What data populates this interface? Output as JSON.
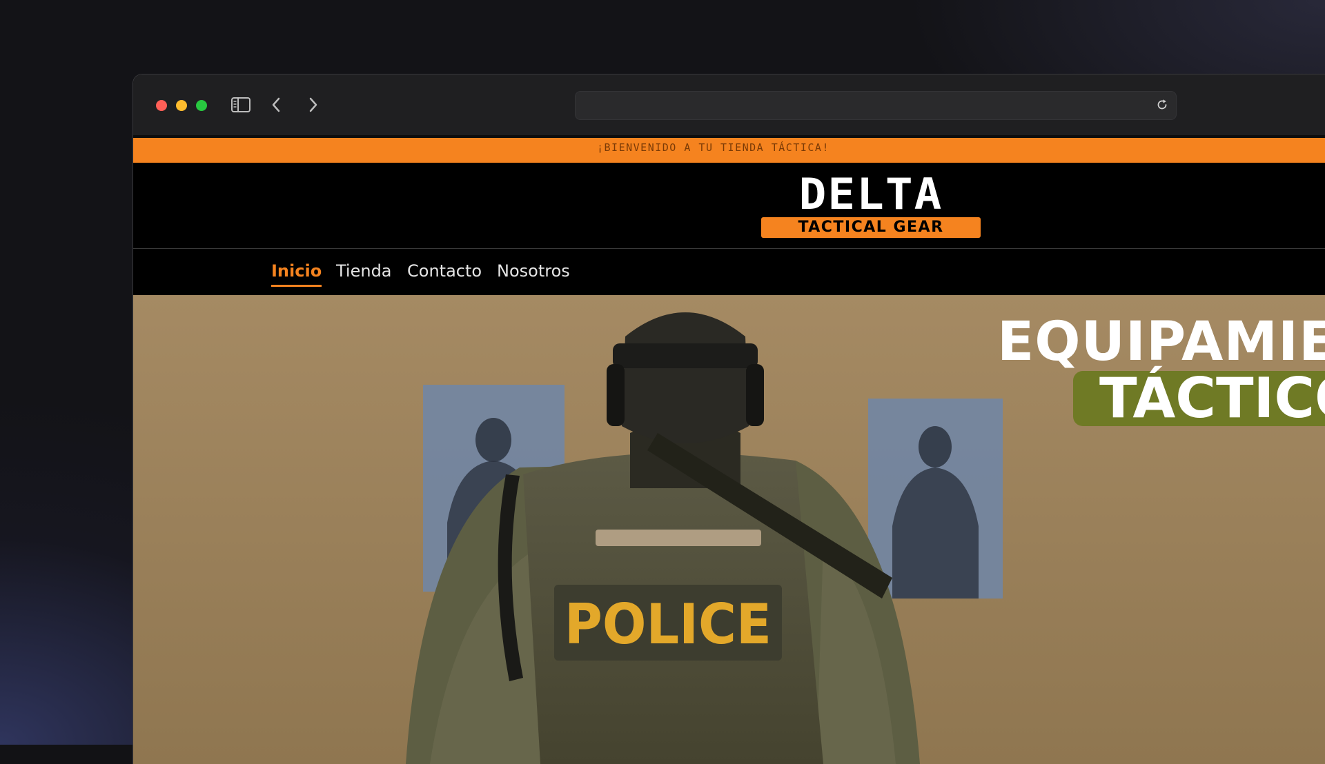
{
  "browser": {
    "url": "",
    "traffic_lights": {
      "close": "#ff5f57",
      "minimize": "#febc2e",
      "zoom": "#28c840"
    }
  },
  "site": {
    "announcement": "¡BIENVENIDO A TU TIENDA TÁCTICA!",
    "logo": {
      "word": "DELTA",
      "tagline": "TACTICAL GEAR"
    },
    "nav": [
      {
        "label": "Inicio",
        "active": true
      },
      {
        "label": "Tienda",
        "active": false
      },
      {
        "label": "Contacto",
        "active": false
      },
      {
        "label": "Nosotros",
        "active": false
      }
    ],
    "hero": {
      "title": "EQUIPAMIE",
      "subtitle": "TÁCTICO",
      "patch_text": "POLICE"
    },
    "colors": {
      "accent": "#f5831f",
      "olive": "#6f7a25"
    }
  }
}
